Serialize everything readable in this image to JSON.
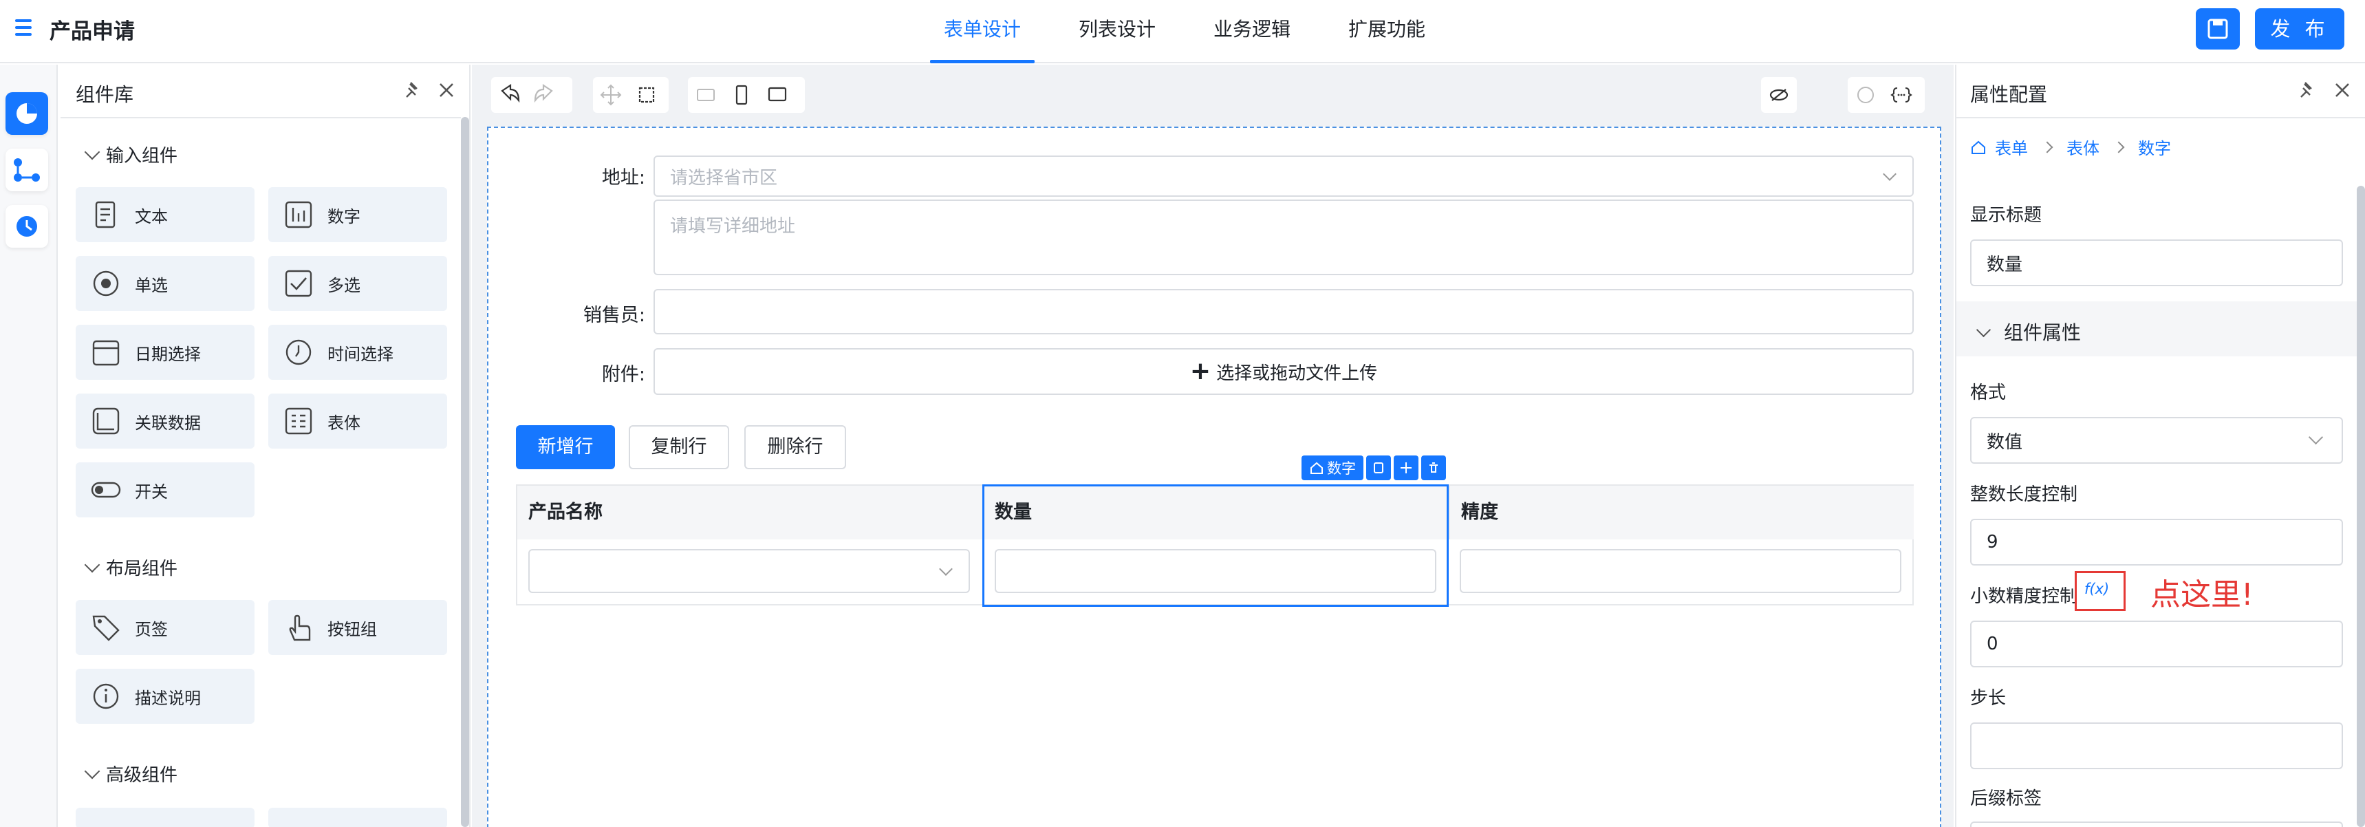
{
  "header": {
    "title": "产品申请",
    "tabs": [
      {
        "label": "表单设计",
        "active": true
      },
      {
        "label": "列表设计",
        "active": false
      },
      {
        "label": "业务逻辑",
        "active": false
      },
      {
        "label": "扩展功能",
        "active": false
      }
    ],
    "publish_label": "发 布",
    "accent_color": "#1677ff"
  },
  "library": {
    "title": "组件库",
    "sections": {
      "input": {
        "label": "输入组件",
        "items": [
          "文本",
          "数字",
          "单选",
          "多选",
          "日期选择",
          "时间选择",
          "关联数据",
          "表体",
          "开关"
        ]
      },
      "layout": {
        "label": "布局组件",
        "items": [
          "页签",
          "按钮组",
          "描述说明"
        ]
      },
      "advanced": {
        "label": "高级组件"
      }
    }
  },
  "form": {
    "address": {
      "label": "地址:",
      "region_placeholder": "请选择省市区",
      "detail_placeholder": "请填写详细地址"
    },
    "salesperson": {
      "label": "销售员:",
      "value": ""
    },
    "attachment": {
      "label": "附件:",
      "upload_text": "选择或拖动文件上传"
    },
    "buttons": {
      "add_row": "新增行",
      "copy_row": "复制行",
      "delete_row": "删除行"
    },
    "table": {
      "columns": [
        "产品名称",
        "数量",
        "精度"
      ],
      "selected_column": "数量",
      "selected_badge": "数字"
    }
  },
  "properties": {
    "title": "属性配置",
    "breadcrumb": [
      "表单",
      "表体",
      "数字"
    ],
    "display_title": {
      "label": "显示标题",
      "value": "数量"
    },
    "group": {
      "label": "组件属性"
    },
    "format": {
      "label": "格式",
      "value": "数值"
    },
    "int_length": {
      "label": "整数长度控制",
      "value": "9"
    },
    "decimal_precision": {
      "label": "小数精度控制",
      "fx_label": "f(x)",
      "value": "0"
    },
    "step": {
      "label": "步长",
      "value": ""
    },
    "suffix": {
      "label": "后缀标签"
    },
    "annotation": "点这里!",
    "annotation_color": "#e53935"
  }
}
